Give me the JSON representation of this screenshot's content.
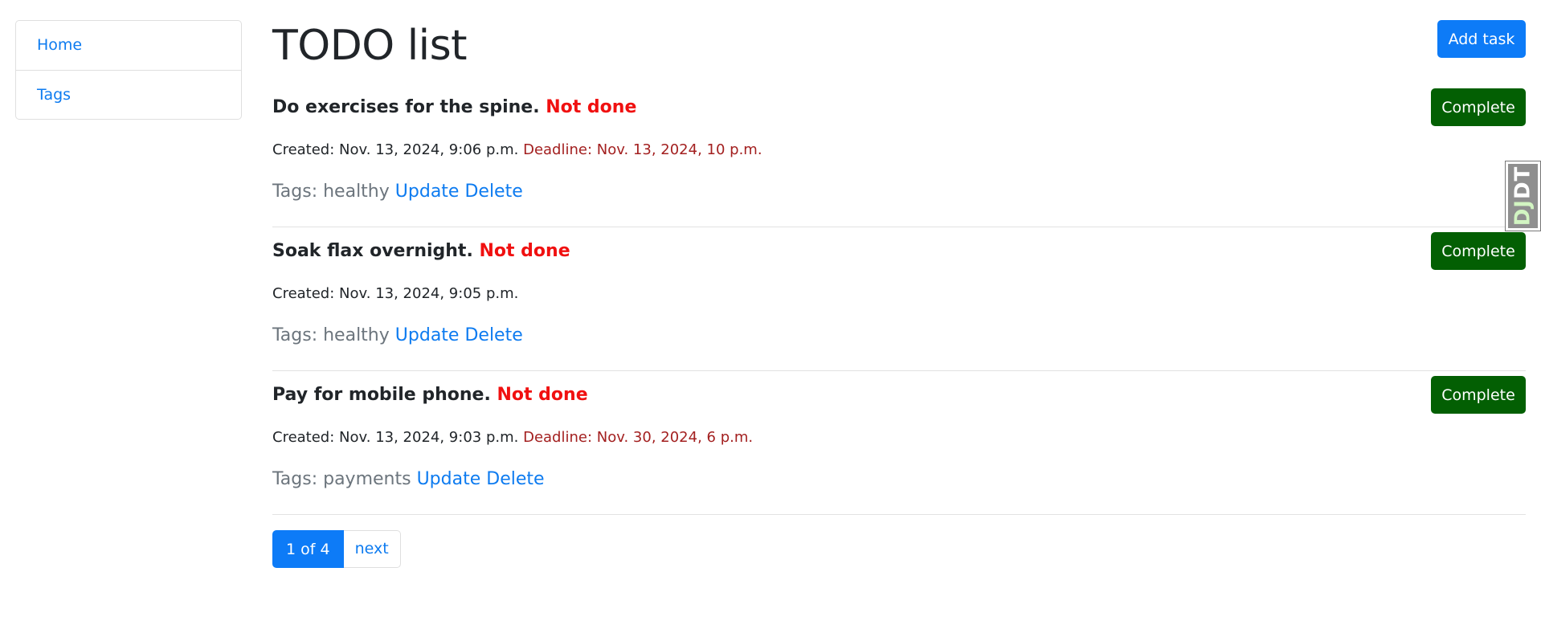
{
  "sidebar": {
    "items": [
      {
        "label": "Home"
      },
      {
        "label": "Tags"
      }
    ]
  },
  "header": {
    "title": "TODO list",
    "add_label": "Add task"
  },
  "tasks": [
    {
      "title": "Do exercises for the spine.",
      "status": "Not done",
      "created": "Created: Nov. 13, 2024, 9:06 p.m.",
      "deadline": "Deadline: Nov. 13, 2024, 10 p.m.",
      "tags": "Tags: healthy",
      "update": "Update",
      "delete": "Delete",
      "complete": "Complete"
    },
    {
      "title": "Soak flax overnight.",
      "status": "Not done",
      "created": "Created: Nov. 13, 2024, 9:05 p.m.",
      "deadline": "",
      "tags": "Tags: healthy",
      "update": "Update",
      "delete": "Delete",
      "complete": "Complete"
    },
    {
      "title": "Pay for mobile phone.",
      "status": "Not done",
      "created": "Created: Nov. 13, 2024, 9:03 p.m.",
      "deadline": "Deadline: Nov. 30, 2024, 6 p.m.",
      "tags": "Tags: payments",
      "update": "Update",
      "delete": "Delete",
      "complete": "Complete"
    }
  ],
  "pagination": {
    "current": "1 of 4",
    "next": "next"
  },
  "debug_toolbar": {
    "dj": "DJ",
    "dt": "DT"
  },
  "colors": {
    "accent": "#0d7bf7",
    "complete": "#035f03",
    "status_not_done": "#f01010",
    "deadline": "#a32020"
  }
}
